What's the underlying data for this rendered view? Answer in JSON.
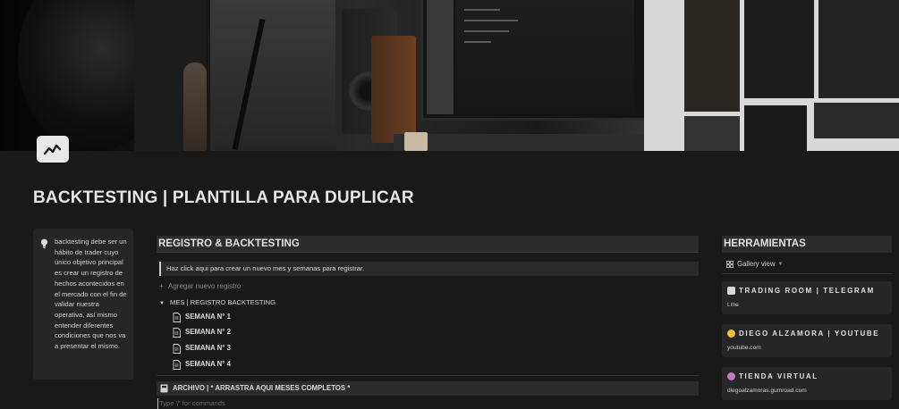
{
  "page": {
    "title": "BACKTESTING | PLANTILLA PARA DUPLICAR",
    "icon": "chart-trend-icon"
  },
  "callout": {
    "icon": "lightbulb-icon",
    "text": "backtesting debe ser un hábito de trader cuyo único objetivo principal es crear un registro de hechos acontecidos en el mercado con el fin de validar nuestra operativa, así mismo entender diferentes condiciones que nos va a presentar el mismo."
  },
  "registro": {
    "heading": "REGISTRO & BACKTESTING",
    "hint": "Haz click aqui para crear un nuevo mes y semanas para registrar.",
    "add_label": "Agregar nuevo registro",
    "toggle_label": "MES | REGISTRO BACKTESTING",
    "weeks": [
      "SEMANA N° 1",
      "SEMANA N° 2",
      "SEMANA N° 3",
      "SEMANA N° 4"
    ],
    "archive_label": "ARCHIVO | * ARRASTRA AQUI MESES COMPLETOS *",
    "placeholder": "Type '/' for commands"
  },
  "herramientas": {
    "heading": "HERRAMIENTAS",
    "view_label": "Gallery view",
    "cards": [
      {
        "name": "TRADING ROOM | TELEGRAM",
        "url": "t.me",
        "emoji_color": "#d9d9d9"
      },
      {
        "name": "DIEGO ALZAMORA | YOUTUBE",
        "url": "youtube.com",
        "emoji_color": "#f2c230"
      },
      {
        "name": "TIENDA VIRTUAL",
        "url": "diegoalzamoras.gumroad.com",
        "emoji_color": "#c678c8"
      }
    ]
  },
  "colors": {
    "background": "#191919",
    "block": "#2c2c2c",
    "text": "#d4d4d4"
  }
}
